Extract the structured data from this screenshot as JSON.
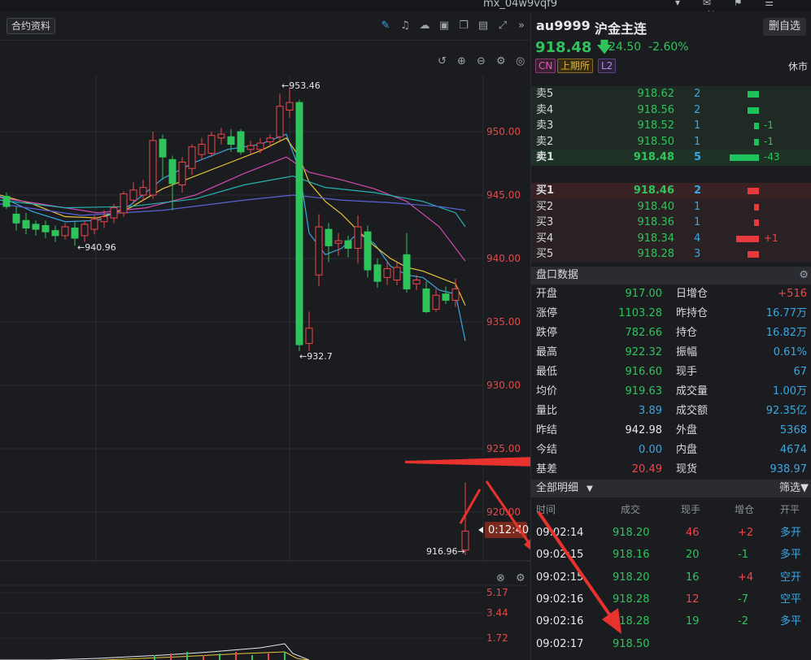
{
  "topbar": {
    "user": "mx_04w9vqf9"
  },
  "toolbar": {
    "contract_info_label": "合约资料"
  },
  "chart": {
    "price_axis_labels": [
      "950.00",
      "945.00",
      "940.00",
      "935.00",
      "930.00",
      "925.00",
      "920.00"
    ],
    "sub_axis_labels": [
      "5.17",
      "3.44",
      "1.72"
    ],
    "annotations": {
      "high": "953.46",
      "low": "932.7",
      "left_low": "940.96",
      "last_low": "916.96"
    },
    "countdown": "0:12:40",
    "colors": {
      "up": "#f0464b",
      "down": "#2fc45b",
      "bg": "#1b1c20",
      "grid": "#2a2c32"
    }
  },
  "quote": {
    "symbol": "au9999",
    "name": "沪金主连",
    "delete_label": "删自选",
    "price": "918.48",
    "change": "-24.50",
    "change_pct": "-2.60%",
    "tags": [
      "CN",
      "上期所",
      "L2"
    ],
    "status": "休市"
  },
  "orderbook": {
    "asks": [
      {
        "label": "卖5",
        "price": "918.62",
        "vol": "2",
        "delta": ""
      },
      {
        "label": "卖4",
        "price": "918.56",
        "vol": "2",
        "delta": ""
      },
      {
        "label": "卖3",
        "price": "918.52",
        "vol": "1",
        "delta": "-1"
      },
      {
        "label": "卖2",
        "price": "918.50",
        "vol": "1",
        "delta": "-1"
      },
      {
        "label": "卖1",
        "price": "918.48",
        "vol": "5",
        "delta": "-43"
      }
    ],
    "bids": [
      {
        "label": "买1",
        "price": "918.46",
        "vol": "2",
        "delta": ""
      },
      {
        "label": "买2",
        "price": "918.40",
        "vol": "1",
        "delta": ""
      },
      {
        "label": "买3",
        "price": "918.36",
        "vol": "1",
        "delta": ""
      },
      {
        "label": "买4",
        "price": "918.34",
        "vol": "4",
        "delta": "+1"
      },
      {
        "label": "买5",
        "price": "918.28",
        "vol": "3",
        "delta": ""
      }
    ]
  },
  "stats": {
    "title": "盘口数据",
    "left": [
      {
        "label": "开盘",
        "value": "917.00",
        "color": "green"
      },
      {
        "label": "涨停",
        "value": "1103.28",
        "color": "green"
      },
      {
        "label": "跌停",
        "value": "782.66",
        "color": "green"
      },
      {
        "label": "最高",
        "value": "922.32",
        "color": "green"
      },
      {
        "label": "最低",
        "value": "916.60",
        "color": "green"
      },
      {
        "label": "均价",
        "value": "919.63",
        "color": "green"
      },
      {
        "label": "量比",
        "value": "3.89",
        "color": "cyan"
      },
      {
        "label": "昨结",
        "value": "942.98",
        "color": "white"
      },
      {
        "label": "今结",
        "value": "0.00",
        "color": "cyan"
      },
      {
        "label": "基差",
        "value": "20.49",
        "color": "red"
      }
    ],
    "right": [
      {
        "label": "日增仓",
        "value": "+516",
        "color": "red"
      },
      {
        "label": "昨持仓",
        "value": "16.77万",
        "color": "cyan"
      },
      {
        "label": "持仓",
        "value": "16.82万",
        "color": "cyan"
      },
      {
        "label": "振幅",
        "value": "0.61%",
        "color": "cyan"
      },
      {
        "label": "现手",
        "value": "67",
        "color": "cyan"
      },
      {
        "label": "成交量",
        "value": "1.00万",
        "color": "cyan"
      },
      {
        "label": "成交额",
        "value": "92.35亿",
        "color": "cyan"
      },
      {
        "label": "外盘",
        "value": "5368",
        "color": "cyan"
      },
      {
        "label": "内盘",
        "value": "4674",
        "color": "cyan"
      },
      {
        "label": "现货",
        "value": "938.97",
        "color": "cyan"
      }
    ]
  },
  "trades": {
    "title": "全部明细",
    "filter_label": "筛选",
    "headers": [
      "时间",
      "成交",
      "现手",
      "增仓",
      "开平"
    ],
    "rows": [
      {
        "time": "09:02:14",
        "price": "918.20",
        "vol": "46",
        "oi": "+2",
        "type": "多开",
        "vol_color": "red",
        "oi_color": "red"
      },
      {
        "time": "09:02:15",
        "price": "918.16",
        "vol": "20",
        "oi": "-1",
        "type": "多平",
        "vol_color": "green",
        "oi_color": "green"
      },
      {
        "time": "09:02:15",
        "price": "918.20",
        "vol": "16",
        "oi": "+4",
        "type": "空开",
        "vol_color": "green",
        "oi_color": "red"
      },
      {
        "time": "09:02:16",
        "price": "918.28",
        "vol": "12",
        "oi": "-7",
        "type": "空平",
        "vol_color": "red",
        "oi_color": "green"
      },
      {
        "time": "09:02:16",
        "price": "918.28",
        "vol": "19",
        "oi": "-2",
        "type": "多平",
        "vol_color": "green",
        "oi_color": "green"
      },
      {
        "time": "09:02:17",
        "price": "918.50",
        "vol": "",
        "oi": "",
        "type": "",
        "vol_color": "red",
        "oi_color": "red"
      }
    ]
  }
}
